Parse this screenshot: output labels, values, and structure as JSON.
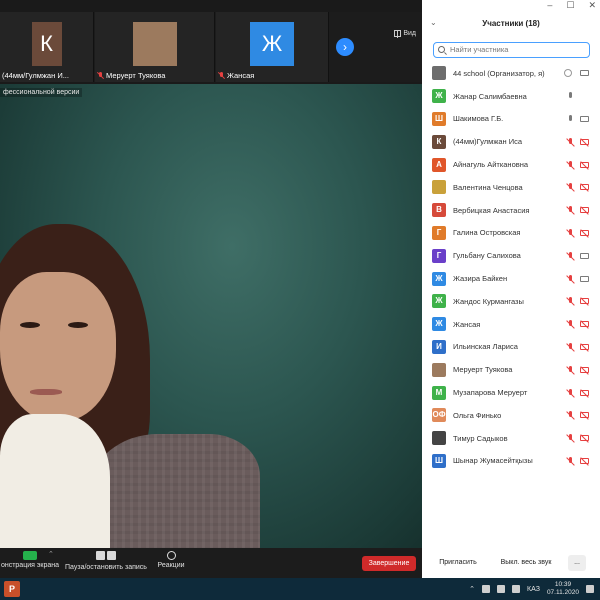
{
  "window": {
    "minimize": "–",
    "maximize": "☐",
    "close": "✕"
  },
  "strip": {
    "tiles": [
      {
        "initial": "К",
        "name": "(44мм/Гулмжан И...",
        "color": "#6b4a3a"
      },
      {
        "initial": "",
        "name": "Меруерт Туякова",
        "color": "#9c7a5e"
      },
      {
        "initial": "Ж",
        "name": "Жансая",
        "color": "#2f8ae3"
      }
    ],
    "next_label": "›",
    "view_label": "Вид"
  },
  "speaker": {
    "watermark": "фессиональной версии"
  },
  "toolbar": {
    "share_label": "онстрация экрана",
    "pause_label": "Пауза/остановить запись",
    "reactions_label": "Реакции",
    "end_label": "Завершение"
  },
  "panel": {
    "title": "Участники (18)",
    "collapse": "⌄",
    "search_placeholder": "Найти участника",
    "participants": [
      {
        "initial": "",
        "name": "44 school (Организатор, я)",
        "color": "#6d6d6d",
        "mic": "info",
        "cam": "on"
      },
      {
        "initial": "Ж",
        "name": "Жанар Салимбаевна",
        "color": "#3fb24a",
        "mic": "on",
        "cam": "none"
      },
      {
        "initial": "Ш",
        "name": "Шакимова Г.Б.",
        "color": "#e07b2a",
        "mic": "on",
        "cam": "on"
      },
      {
        "initial": "К",
        "name": "(44мм)Гулмжан Иса",
        "color": "#6b4a3a",
        "mic": "off",
        "cam": "off"
      },
      {
        "initial": "А",
        "name": "Айнагуль Айткановна",
        "color": "#e0562a",
        "mic": "off",
        "cam": "off"
      },
      {
        "initial": "",
        "name": "Валентина Ченцова",
        "color": "#c9a13a",
        "mic": "off",
        "cam": "off"
      },
      {
        "initial": "В",
        "name": "Вербицкая Анастасия",
        "color": "#d64a3a",
        "mic": "off",
        "cam": "off"
      },
      {
        "initial": "Г",
        "name": "Галина Островская",
        "color": "#e07b2a",
        "mic": "off",
        "cam": "off"
      },
      {
        "initial": "Г",
        "name": "Гульбану Салихова",
        "color": "#6a3fc9",
        "mic": "off",
        "cam": "on"
      },
      {
        "initial": "Ж",
        "name": "Жазира Байкен",
        "color": "#2f8ae3",
        "mic": "off",
        "cam": "on"
      },
      {
        "initial": "Ж",
        "name": "Жандос Курмангазы",
        "color": "#3fb24a",
        "mic": "off",
        "cam": "off"
      },
      {
        "initial": "Ж",
        "name": "Жансая",
        "color": "#2f8ae3",
        "mic": "off",
        "cam": "off"
      },
      {
        "initial": "И",
        "name": "Ильинская Лариса",
        "color": "#2f6fc9",
        "mic": "off",
        "cam": "off"
      },
      {
        "initial": "",
        "name": "Меруерт Туякова",
        "color": "#9c7a5e",
        "mic": "off",
        "cam": "off"
      },
      {
        "initial": "М",
        "name": "Музапарова Меруерт",
        "color": "#3fb24a",
        "mic": "off",
        "cam": "off"
      },
      {
        "initial": "ОФ",
        "name": "Ольга Финько",
        "color": "#e08a5a",
        "mic": "off",
        "cam": "off"
      },
      {
        "initial": "",
        "name": "Тимур Садыков",
        "color": "#444444",
        "mic": "off",
        "cam": "off"
      },
      {
        "initial": "Ш",
        "name": "Шынар Жумасейтқызы",
        "color": "#2f6fc9",
        "mic": "off",
        "cam": "off"
      }
    ],
    "invite_label": "Пригласить",
    "mute_all_label": "Выкл. весь звук",
    "more_label": "..."
  },
  "taskbar": {
    "app_icon": "P",
    "lang": "КАЗ",
    "time": "10:39",
    "date": "07.11.2020"
  }
}
